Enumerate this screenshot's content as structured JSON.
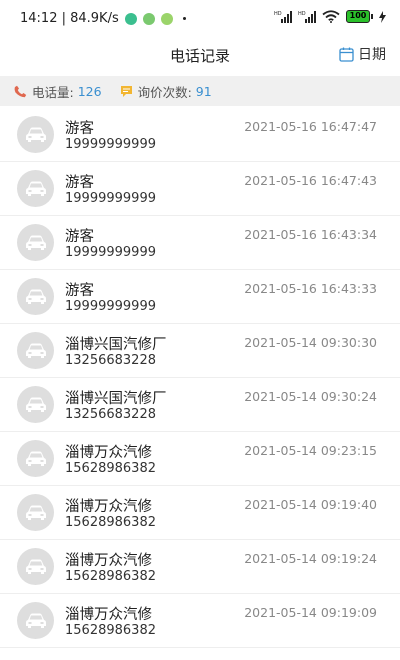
{
  "status_bar": {
    "time_speed": "14:12 | 84.9K/s",
    "battery": "100"
  },
  "header": {
    "title": "电话记录",
    "date_label": "日期"
  },
  "stats": {
    "calls_label": "电话量:",
    "calls_value": "126",
    "inquiries_label": "询价次数:",
    "inquiries_value": "91"
  },
  "records": [
    {
      "name": "游客",
      "phone": "19999999999",
      "time": "2021-05-16 16:47:47"
    },
    {
      "name": "游客",
      "phone": "19999999999",
      "time": "2021-05-16 16:47:43"
    },
    {
      "name": "游客",
      "phone": "19999999999",
      "time": "2021-05-16 16:43:34"
    },
    {
      "name": "游客",
      "phone": "19999999999",
      "time": "2021-05-16 16:43:33"
    },
    {
      "name": "淄博兴国汽修厂",
      "phone": "13256683228",
      "time": "2021-05-14 09:30:30"
    },
    {
      "name": "淄博兴国汽修厂",
      "phone": "13256683228",
      "time": "2021-05-14 09:30:24"
    },
    {
      "name": "淄博万众汽修",
      "phone": "15628986382",
      "time": "2021-05-14 09:23:15"
    },
    {
      "name": "淄博万众汽修",
      "phone": "15628986382",
      "time": "2021-05-14 09:19:40"
    },
    {
      "name": "淄博万众汽修",
      "phone": "15628986382",
      "time": "2021-05-14 09:19:24"
    },
    {
      "name": "淄博万众汽修",
      "phone": "15628986382",
      "time": "2021-05-14 09:19:09"
    }
  ],
  "colors": {
    "accent": "#3a8fd0",
    "phone_icon": "#e0684f",
    "message_icon": "#f2b632",
    "avatar_bg": "#dedede"
  }
}
